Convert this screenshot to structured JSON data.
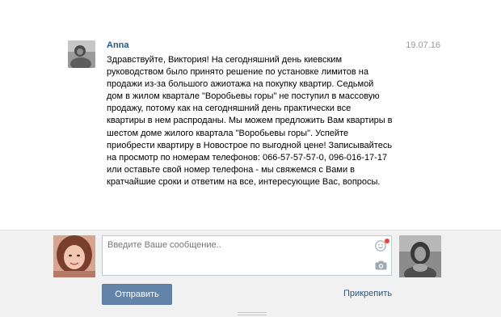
{
  "message": {
    "author": "Anna",
    "date": "19.07.16",
    "text": "Здравствуйте, Виктория! На сегодняшний день киевским\nруководством было принято решение по установке лимитов на\nпродажи из-за большого ажиотажа на покупку квартир. Седьмой\nдом в жилом квартале \"Воробьевы горы\" не поступил в массовую\nпродажу, потому как на сегодняшний день практически все\nквартиры в нем распроданы. Мы можем предложить Вам квартиры в\nшестом доме жилого квартала \"Воробьевы горы\". Успейте\nприобрести квартиру в Новострое по выгодной цене! Записывайтесь\nна просмотр по номерам телефонов: 066-57-57-57-0, 096-016-17-17\nили оставьте свой номер телефона - мы свяжемся с Вами в\nкратчайшие сроки и ответим на все, интересующие Вас, вопросы."
  },
  "composer": {
    "placeholder": "Введите Ваше сообщение..",
    "value": "",
    "send_label": "Отправить",
    "attach_label": "Прикрепить"
  },
  "icons": {
    "smile": "smile-icon",
    "camera": "camera-icon",
    "notify": "notification-dot"
  },
  "colors": {
    "send_button": "#6383a8",
    "link": "#2b587a",
    "composer_bg": "#f1f1f1",
    "notify_dot": "#e4453a"
  }
}
